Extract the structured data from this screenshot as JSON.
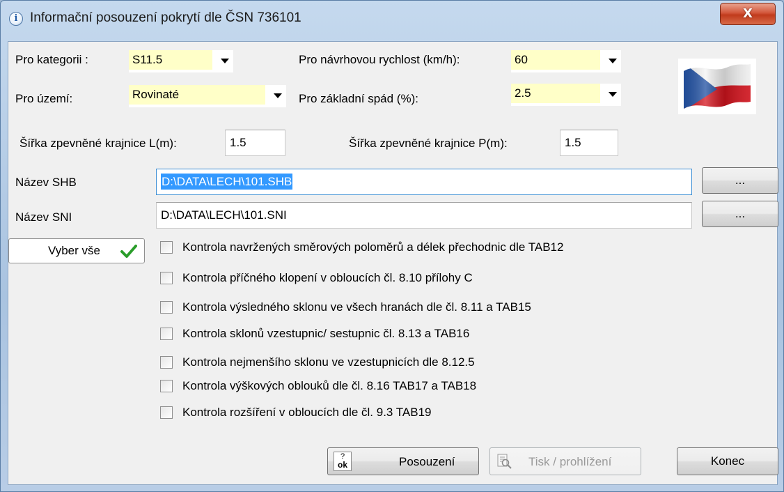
{
  "window": {
    "title": "Informační posouzení  pokrytí dle ČSN 736101",
    "info_icon_glyph": "i",
    "close_glyph": "X"
  },
  "form": {
    "category": {
      "label": "Pro kategorii :",
      "value": "S11.5"
    },
    "terrain": {
      "label": "Pro území:",
      "value": "Rovinaté"
    },
    "speed": {
      "label": "Pro návrhovou rychlost (km/h):",
      "value": "60"
    },
    "slope": {
      "label": "Pro základní spád (%):",
      "value": "2.5"
    },
    "shoulder_left": {
      "label": "Šířka zpevněné krajnice L(m):",
      "value": "1.5"
    },
    "shoulder_right": {
      "label": "Šířka zpevněné krajnice P(m):",
      "value": "1.5"
    },
    "shb": {
      "label": "Název SHB",
      "value": "D:\\DATA\\LECH\\101.SHB",
      "browse": "..."
    },
    "sni": {
      "label": "Název SNI",
      "value": "D:\\DATA\\LECH\\101.SNI",
      "browse": "..."
    }
  },
  "select_all": {
    "label": "Vyber vše"
  },
  "checks": [
    {
      "label": "Kontrola navržených  směrových poloměrů a délek přechodnic dle TAB12",
      "checked": false
    },
    {
      "label": "Kontrola příčného klopení v obloucích čl. 8.10 přílohy C",
      "checked": false
    },
    {
      "label": "Kontrola výsledného sklonu ve všech hranách dle čl. 8.11 a TAB15",
      "checked": false
    },
    {
      "label": "Kontrola sklonů vzestupnic/ sestupnic čl. 8.13 a TAB16",
      "checked": false
    },
    {
      "label": "Kontrola nejmenšího sklonu ve vzestupnicích dle 8.12.5",
      "checked": false
    },
    {
      "label": "Kontrola výškových oblouků dle čl. 8.16 TAB17 a TAB18",
      "checked": false
    },
    {
      "label": "Kontrola rozšíření v obloucích dle čl. 9.3 TAB19",
      "checked": false
    }
  ],
  "buttons": {
    "assess": {
      "label": "Posouzení",
      "icon_text_top": "?",
      "icon_text_bottom": "ok"
    },
    "print": {
      "label": "Tisk / prohlížení"
    },
    "close": {
      "label": "Konec"
    }
  },
  "colors": {
    "combo_highlight": "#ffffc8",
    "selection": "#3399ff",
    "check_mark": "#2a9d2a"
  }
}
